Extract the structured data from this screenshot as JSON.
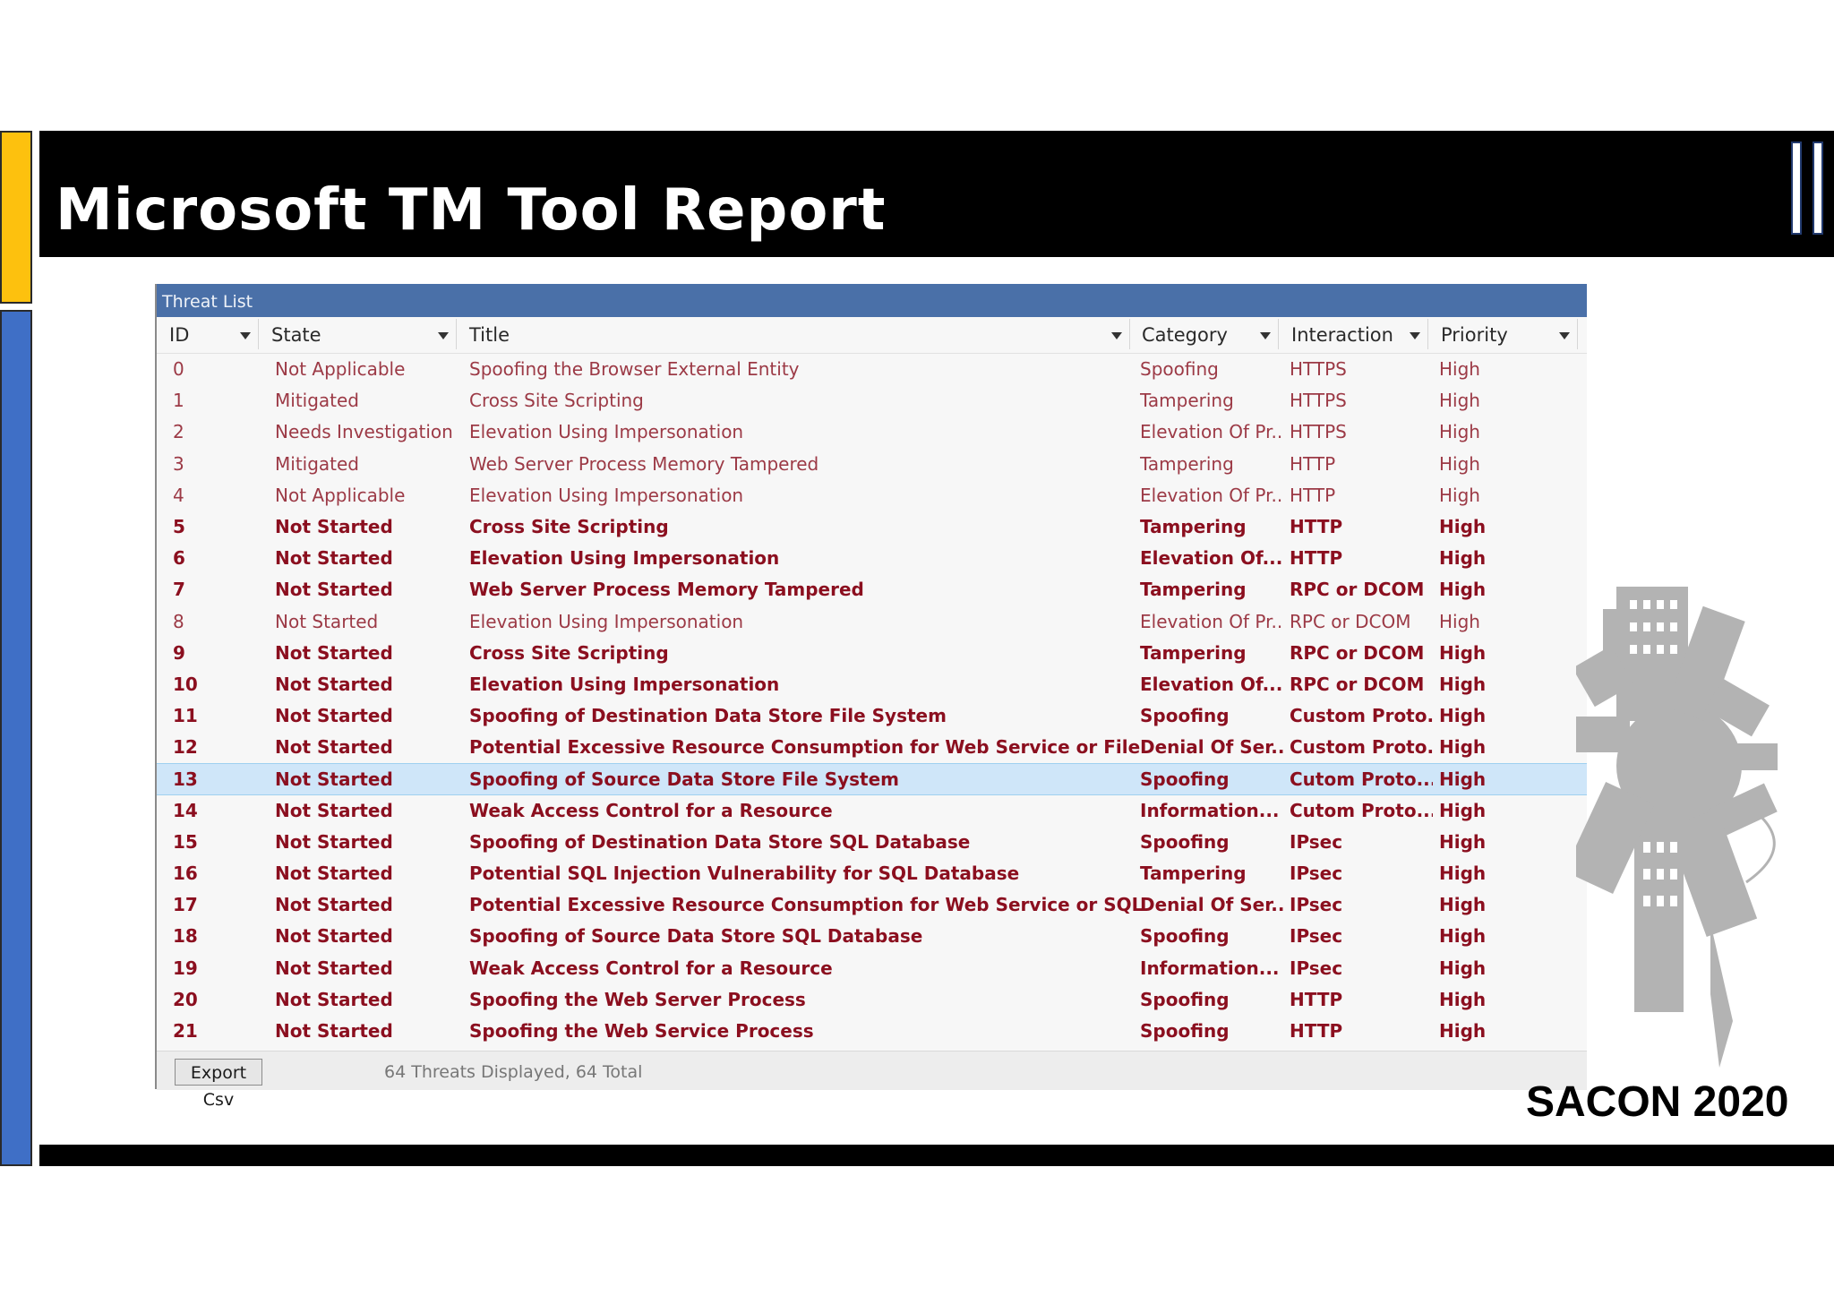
{
  "slide": {
    "title": "Microsoft TM Tool Report",
    "event": "SACON 2020",
    "accent_yellow": "#fdc10e",
    "accent_blue": "#3f6fc6"
  },
  "window": {
    "title": "Threat List",
    "columns": [
      "ID",
      "State",
      "Title",
      "Category",
      "Interaction",
      "Priority"
    ],
    "rows": [
      {
        "id": "0",
        "state": "Not Applicable",
        "title": "Spoofing the Browser External Entity",
        "category": "Spoofing",
        "interaction": "HTTPS",
        "priority": "High",
        "style": "plain"
      },
      {
        "id": "1",
        "state": "Mitigated",
        "title": "Cross Site Scripting",
        "category": "Tampering",
        "interaction": "HTTPS",
        "priority": "High",
        "style": "plain"
      },
      {
        "id": "2",
        "state": "Needs Investigation",
        "title": "Elevation Using Impersonation",
        "category": "Elevation Of Pr...",
        "interaction": "HTTPS",
        "priority": "High",
        "style": "plain"
      },
      {
        "id": "3",
        "state": "Mitigated",
        "title": "Web Server Process Memory Tampered",
        "category": "Tampering",
        "interaction": "HTTP",
        "priority": "High",
        "style": "plain"
      },
      {
        "id": "4",
        "state": "Not Applicable",
        "title": "Elevation Using Impersonation",
        "category": "Elevation Of Pr...",
        "interaction": "HTTP",
        "priority": "High",
        "style": "plain"
      },
      {
        "id": "5",
        "state": "Not Started",
        "title": "Cross Site Scripting",
        "category": "Tampering",
        "interaction": "HTTP",
        "priority": "High",
        "style": "bold"
      },
      {
        "id": "6",
        "state": "Not Started",
        "title": "Elevation Using Impersonation",
        "category": "Elevation Of...",
        "interaction": "HTTP",
        "priority": "High",
        "style": "bold"
      },
      {
        "id": "7",
        "state": "Not Started",
        "title": "Web Server Process Memory Tampered",
        "category": "Tampering",
        "interaction": "RPC or DCOM",
        "priority": "High",
        "style": "bold"
      },
      {
        "id": "8",
        "state": "Not Started",
        "title": "Elevation Using Impersonation",
        "category": "Elevation Of Pr...",
        "interaction": "RPC or DCOM",
        "priority": "High",
        "style": "plain"
      },
      {
        "id": "9",
        "state": "Not Started",
        "title": "Cross Site Scripting",
        "category": "Tampering",
        "interaction": "RPC or DCOM",
        "priority": "High",
        "style": "bold"
      },
      {
        "id": "10",
        "state": "Not Started",
        "title": "Elevation Using Impersonation",
        "category": "Elevation Of...",
        "interaction": "RPC or DCOM",
        "priority": "High",
        "style": "bold"
      },
      {
        "id": "11",
        "state": "Not Started",
        "title": "Spoofing of Destination Data Store File System",
        "category": "Spoofing",
        "interaction": "Custom Proto...",
        "priority": "High",
        "style": "bold"
      },
      {
        "id": "12",
        "state": "Not Started",
        "title": "Potential Excessive Resource Consumption for Web Service or File System",
        "category": "Denial Of Ser...",
        "interaction": "Custom Proto...",
        "priority": "High",
        "style": "bold"
      },
      {
        "id": "13",
        "state": "Not Started",
        "title": "Spoofing of Source Data Store File System",
        "category": "Spoofing",
        "interaction": "Cutom Proto...",
        "priority": "High",
        "style": "bold sel"
      },
      {
        "id": "14",
        "state": "Not Started",
        "title": "Weak Access Control for a Resource",
        "category": "Information...",
        "interaction": "Cutom Proto...",
        "priority": "High",
        "style": "bold"
      },
      {
        "id": "15",
        "state": "Not Started",
        "title": "Spoofing of Destination Data Store SQL Database",
        "category": "Spoofing",
        "interaction": "IPsec",
        "priority": "High",
        "style": "bold"
      },
      {
        "id": "16",
        "state": "Not Started",
        "title": "Potential SQL Injection Vulnerability for SQL Database",
        "category": "Tampering",
        "interaction": "IPsec",
        "priority": "High",
        "style": "bold"
      },
      {
        "id": "17",
        "state": "Not Started",
        "title": "Potential Excessive Resource Consumption for Web Service or SQL Database",
        "category": "Denial Of Ser...",
        "interaction": "IPsec",
        "priority": "High",
        "style": "bold"
      },
      {
        "id": "18",
        "state": "Not Started",
        "title": "Spoofing of Source Data Store SQL Database",
        "category": "Spoofing",
        "interaction": "IPsec",
        "priority": "High",
        "style": "bold"
      },
      {
        "id": "19",
        "state": "Not Started",
        "title": "Weak Access Control for a Resource",
        "category": "Information...",
        "interaction": "IPsec",
        "priority": "High",
        "style": "bold"
      },
      {
        "id": "20",
        "state": "Not Started",
        "title": "Spoofing the Web Server Process",
        "category": "Spoofing",
        "interaction": "HTTP",
        "priority": "High",
        "style": "bold"
      },
      {
        "id": "21",
        "state": "Not Started",
        "title": "Spoofing the Web Service Process",
        "category": "Spoofing",
        "interaction": "HTTP",
        "priority": "High",
        "style": "bold"
      }
    ],
    "footer": {
      "export_label": "Export Csv",
      "status": "64 Threats Displayed, 64 Total"
    }
  }
}
